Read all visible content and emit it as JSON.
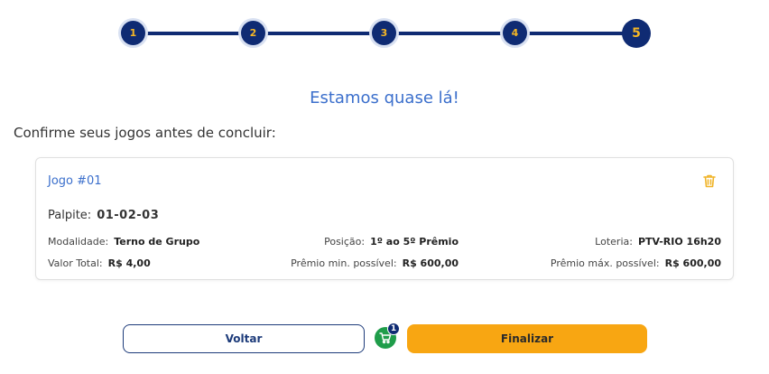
{
  "stepper": {
    "steps": [
      "1",
      "2",
      "3",
      "4",
      "5"
    ],
    "current": 5
  },
  "headline": "Estamos quase lá!",
  "subheading": "Confirme seus jogos antes de concluir:",
  "game": {
    "title": "Jogo #01",
    "palpite_label": "Palpite:",
    "palpite_value": "01-02-03",
    "modalidade_label": "Modalidade:",
    "modalidade_value": "Terno de Grupo",
    "posicao_label": "Posição:",
    "posicao_value": "1º ao 5º Prêmio",
    "loteria_label": "Loteria:",
    "loteria_value": "PTV-RIO 16h20",
    "valor_total_label": "Valor Total:",
    "valor_total_value": "R$ 4,00",
    "premio_min_label": "Prêmio min. possível:",
    "premio_min_value": "R$ 600,00",
    "premio_max_label": "Prêmio máx. possível:",
    "premio_max_value": "R$ 600,00",
    "delete_icon": "trash-icon"
  },
  "actions": {
    "back_label": "Voltar",
    "finish_label": "Finalizar",
    "cart_icon": "cart-icon",
    "cart_count": "1"
  },
  "colors": {
    "primary": "#0f2b73",
    "accent": "#f8a612",
    "link": "#3b6fcc",
    "cart": "#1f9d4a"
  }
}
